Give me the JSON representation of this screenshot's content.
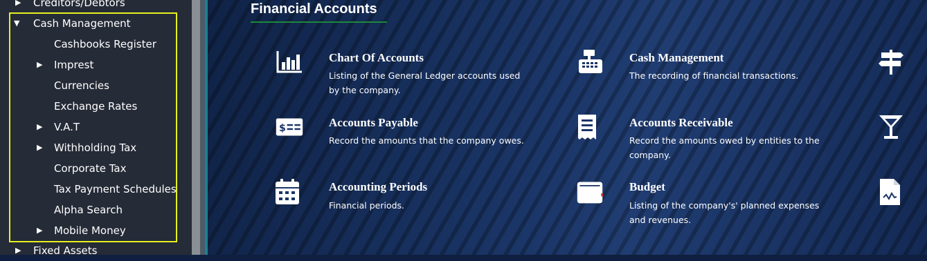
{
  "sidebar": {
    "items": [
      {
        "label": "Creditors/Debtors",
        "arrow": "right"
      },
      {
        "label": "Cash Management",
        "arrow": "down"
      },
      {
        "label": "Cashbooks Register",
        "arrow": ""
      },
      {
        "label": "Imprest",
        "arrow": "right"
      },
      {
        "label": "Currencies",
        "arrow": ""
      },
      {
        "label": "Exchange Rates",
        "arrow": ""
      },
      {
        "label": "V.A.T",
        "arrow": "right"
      },
      {
        "label": "Withholding Tax",
        "arrow": "right"
      },
      {
        "label": "Corporate Tax",
        "arrow": ""
      },
      {
        "label": "Tax Payment Schedules",
        "arrow": ""
      },
      {
        "label": "Alpha Search",
        "arrow": ""
      },
      {
        "label": "Mobile Money",
        "arrow": "right"
      },
      {
        "label": "Fixed Assets",
        "arrow": "right"
      }
    ],
    "highlight_color": "#e6f21c"
  },
  "main": {
    "title": "Financial Accounts",
    "cards": [
      {
        "icon": "bar-chart-icon",
        "title": "Chart Of Accounts",
        "desc": "Listing of the General Ledger accounts used by the company."
      },
      {
        "icon": "cash-register-icon",
        "title": "Cash Management",
        "desc": "The recording of financial transactions."
      },
      {
        "icon": "cheque-icon",
        "title": "Accounts Payable",
        "desc": "Record the amounts that the company owes."
      },
      {
        "icon": "receipt-icon",
        "title": "Accounts Receivable",
        "desc": "Record the amounts owed by entities to the company."
      },
      {
        "icon": "calendar-icon",
        "title": "Accounting Periods",
        "desc": "Financial periods."
      },
      {
        "icon": "wallet-icon",
        "title": "Budget",
        "desc": "Listing of the company's' planned expenses and revenues."
      }
    ],
    "side_icons": [
      "signpost-icon",
      "cocktail-icon",
      "document-chart-icon"
    ]
  },
  "colors": {
    "sidebar_bg": "#252b37",
    "accent_teal": "#1e7f92",
    "underline_green": "#1c8a3a"
  }
}
